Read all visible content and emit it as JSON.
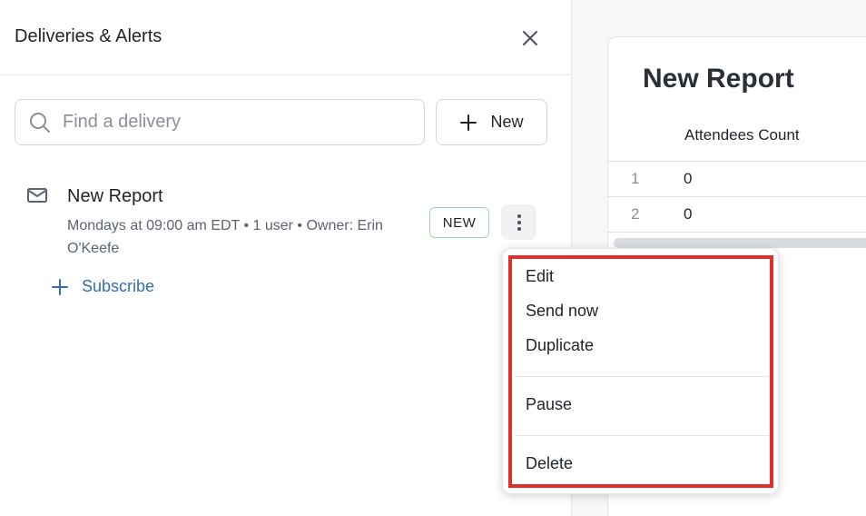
{
  "panel": {
    "title": "Deliveries & Alerts",
    "search_placeholder": "Find a delivery",
    "new_button_label": "New"
  },
  "delivery": {
    "name": "New Report",
    "meta": "Mondays at 09:00 am EDT • 1 user • Owner: Erin O'Keefe",
    "badge": "NEW"
  },
  "subscribe_label": "Subscribe",
  "menu": {
    "items": [
      "Edit",
      "Send now",
      "Duplicate",
      "Pause",
      "Delete"
    ]
  },
  "report": {
    "title": "New Report",
    "column_header": "Attendees Count",
    "rows": [
      {
        "num": "1",
        "value": "0"
      },
      {
        "num": "2",
        "value": "0"
      }
    ]
  },
  "colors": {
    "highlight": "#e0302a",
    "link": "#2f6fb3",
    "badge_border": "#9fd6a7"
  }
}
